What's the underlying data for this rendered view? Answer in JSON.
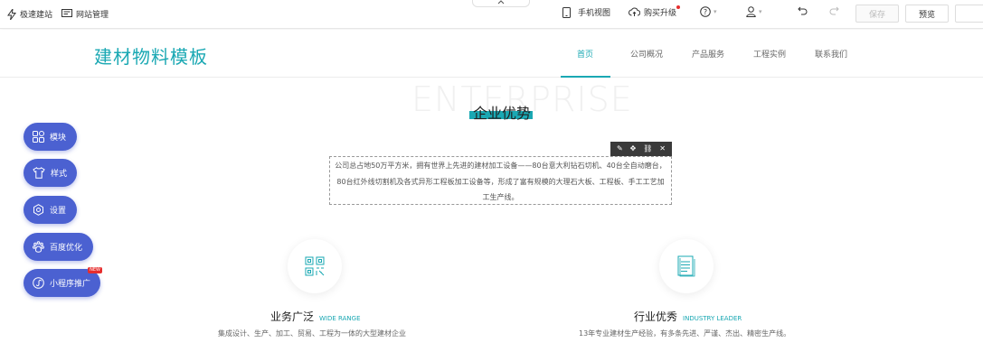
{
  "toolbar": {
    "quick_build": "极速建站",
    "site_manage": "网站管理",
    "mobile_view": "手机视图",
    "buy_upgrade": "购买升级",
    "save": "保存",
    "preview": "预览",
    "icons": [
      "lightning-icon",
      "monitor-icon",
      "mobile-icon",
      "cloud-upload-icon",
      "help-icon",
      "user-icon",
      "undo-icon",
      "redo-icon",
      "chevron-up-icon"
    ]
  },
  "header": {
    "logo": "建材物料模板",
    "nav": [
      "首页",
      "公司概况",
      "产品服务",
      "工程实例",
      "联系我们"
    ],
    "active_index": 0
  },
  "enterprise": {
    "bg_word": "ENTERPRISE",
    "title": "企业优势",
    "intro_lines": [
      "公司总占地50万平方米，拥有世界上先进的建材加工设备——80台意大利钻石切机、40台全自动磨台，",
      "80台红外线切割机及各式异形工程板加工设备等，形成了富有规模的大理石大板、工程板、手工工艺加",
      "工生产线。"
    ]
  },
  "side_menu": [
    {
      "label": "模块",
      "icon": "grid-icon"
    },
    {
      "label": "样式",
      "icon": "shirt-icon"
    },
    {
      "label": "设置",
      "icon": "gear-icon"
    },
    {
      "label": "百度优化",
      "icon": "paw-icon"
    },
    {
      "label": "小程序推广",
      "icon": "mini-program-icon",
      "badge": "NEW"
    }
  ],
  "features": [
    {
      "title": "业务广泛",
      "subtitle": "WIDE RANGE",
      "desc": "集成设计、生产、加工、贸易、工程为一体的大型建材企业",
      "icon": "qrcode-icon"
    },
    {
      "title": "行业优秀",
      "subtitle": "INDUSTRY LEADER",
      "desc": "13年专业建材生产经验，有多条先进、严谨、杰出、精密生产线。",
      "icon": "document-icon"
    }
  ],
  "colors": {
    "accent": "#1aa8b3",
    "fab": "#4b61d1",
    "toolbar_dark": "#3a3a3a"
  }
}
